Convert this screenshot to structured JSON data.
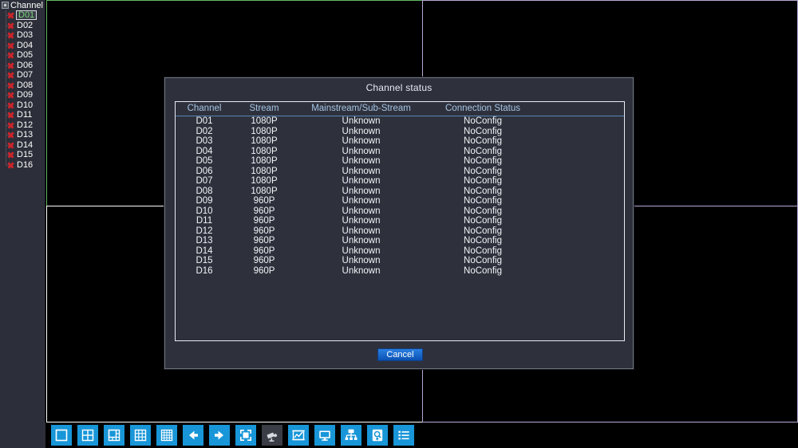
{
  "sidebar": {
    "root_label": "Channel",
    "root_icon": "collapse-box-icon",
    "items": [
      {
        "label": "D01",
        "status_icon": "red-x-icon",
        "selected": true
      },
      {
        "label": "D02",
        "status_icon": "red-x-icon",
        "selected": false
      },
      {
        "label": "D03",
        "status_icon": "red-x-icon",
        "selected": false
      },
      {
        "label": "D04",
        "status_icon": "red-x-icon",
        "selected": false
      },
      {
        "label": "D05",
        "status_icon": "red-x-icon",
        "selected": false
      },
      {
        "label": "D06",
        "status_icon": "red-x-icon",
        "selected": false
      },
      {
        "label": "D07",
        "status_icon": "red-x-icon",
        "selected": false
      },
      {
        "label": "D08",
        "status_icon": "red-x-icon",
        "selected": false
      },
      {
        "label": "D09",
        "status_icon": "red-x-icon",
        "selected": false
      },
      {
        "label": "D10",
        "status_icon": "red-x-icon",
        "selected": false
      },
      {
        "label": "D11",
        "status_icon": "red-x-icon",
        "selected": false
      },
      {
        "label": "D12",
        "status_icon": "red-x-icon",
        "selected": false
      },
      {
        "label": "D13",
        "status_icon": "red-x-icon",
        "selected": false
      },
      {
        "label": "D14",
        "status_icon": "red-x-icon",
        "selected": false
      },
      {
        "label": "D15",
        "status_icon": "red-x-icon",
        "selected": false
      },
      {
        "label": "D16",
        "status_icon": "red-x-icon",
        "selected": false
      }
    ]
  },
  "video": {
    "layout": "2x2",
    "cells": [
      {
        "name": "cell-top-left",
        "border_color": "#63b863",
        "selected": true
      },
      {
        "name": "cell-top-right",
        "border_color": "#b9a8d6",
        "selected": false
      },
      {
        "name": "cell-bottom-left",
        "border_color": "#ffffff",
        "selected": false
      },
      {
        "name": "cell-bottom-right",
        "border_color": "#b9a8d6",
        "selected": false
      }
    ]
  },
  "dialog": {
    "title": "Channel status",
    "cancel_label": "Cancel",
    "columns": [
      "Channel",
      "Stream",
      "Mainstream/Sub-Stream",
      "Connection Status"
    ],
    "rows": [
      {
        "channel": "D01",
        "stream": "1080P",
        "mss": "Unknown",
        "status": "NoConfig"
      },
      {
        "channel": "D02",
        "stream": "1080P",
        "mss": "Unknown",
        "status": "NoConfig"
      },
      {
        "channel": "D03",
        "stream": "1080P",
        "mss": "Unknown",
        "status": "NoConfig"
      },
      {
        "channel": "D04",
        "stream": "1080P",
        "mss": "Unknown",
        "status": "NoConfig"
      },
      {
        "channel": "D05",
        "stream": "1080P",
        "mss": "Unknown",
        "status": "NoConfig"
      },
      {
        "channel": "D06",
        "stream": "1080P",
        "mss": "Unknown",
        "status": "NoConfig"
      },
      {
        "channel": "D07",
        "stream": "1080P",
        "mss": "Unknown",
        "status": "NoConfig"
      },
      {
        "channel": "D08",
        "stream": "1080P",
        "mss": "Unknown",
        "status": "NoConfig"
      },
      {
        "channel": "D09",
        "stream": "960P",
        "mss": "Unknown",
        "status": "NoConfig"
      },
      {
        "channel": "D10",
        "stream": "960P",
        "mss": "Unknown",
        "status": "NoConfig"
      },
      {
        "channel": "D11",
        "stream": "960P",
        "mss": "Unknown",
        "status": "NoConfig"
      },
      {
        "channel": "D12",
        "stream": "960P",
        "mss": "Unknown",
        "status": "NoConfig"
      },
      {
        "channel": "D13",
        "stream": "960P",
        "mss": "Unknown",
        "status": "NoConfig"
      },
      {
        "channel": "D14",
        "stream": "960P",
        "mss": "Unknown",
        "status": "NoConfig"
      },
      {
        "channel": "D15",
        "stream": "960P",
        "mss": "Unknown",
        "status": "NoConfig"
      },
      {
        "channel": "D16",
        "stream": "960P",
        "mss": "Unknown",
        "status": "NoConfig"
      }
    ]
  },
  "toolbar": {
    "buttons": [
      {
        "icon": "layout-1x1-icon",
        "enabled": true
      },
      {
        "icon": "layout-2x2-icon",
        "enabled": true
      },
      {
        "icon": "layout-1plus5-icon",
        "enabled": true
      },
      {
        "icon": "layout-3x3-icon",
        "enabled": true
      },
      {
        "icon": "layout-4x4-icon",
        "enabled": true
      },
      {
        "icon": "arrow-left-icon",
        "enabled": true
      },
      {
        "icon": "arrow-right-icon",
        "enabled": true
      },
      {
        "icon": "fullscreen-icon",
        "enabled": true
      },
      {
        "icon": "ptz-camera-icon",
        "enabled": false
      },
      {
        "icon": "color-chart-icon",
        "enabled": true
      },
      {
        "icon": "monitor-icon",
        "enabled": true
      },
      {
        "icon": "network-tree-icon",
        "enabled": true
      },
      {
        "icon": "hdd-search-icon",
        "enabled": true
      },
      {
        "icon": "list-menu-icon",
        "enabled": true
      }
    ]
  },
  "colors": {
    "accent_blue": "#1896d8",
    "selected_green": "#63b863",
    "header_blue": "#a6c4e4",
    "dialog_bg": "#2e313c",
    "sidebar_bg": "#2c2f39",
    "error_red": "#c9252b",
    "divider_violet": "#b9a8d6"
  }
}
